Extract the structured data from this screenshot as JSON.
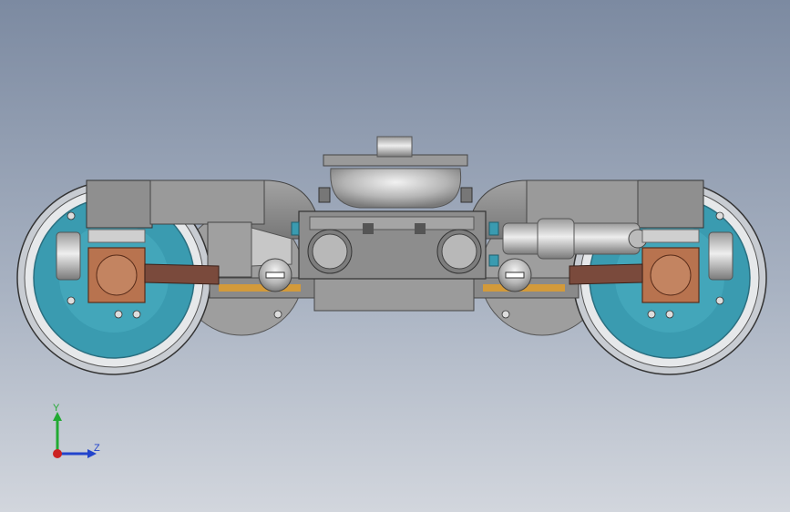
{
  "viewport": {
    "background_top": "#7c8aa1",
    "background_bottom": "#d2d6dd"
  },
  "model": {
    "kind": "railway bogie (side view)",
    "colors": {
      "frame": "#8f8f8f",
      "frame_dark": "#6d6d6d",
      "wheel_outer": "#c8ccd2",
      "wheel_inner": "#3a9bb0",
      "axle_box": "#b8734f",
      "brake_arm": "#7a4a3c",
      "orange": "#d39a3a",
      "chrome": "#d0d0d0"
    }
  },
  "triad": {
    "y_label": "Y",
    "z_label": "Z",
    "y_color": "#22aa33",
    "z_color": "#2244cc",
    "x_color": "#cc2222"
  }
}
